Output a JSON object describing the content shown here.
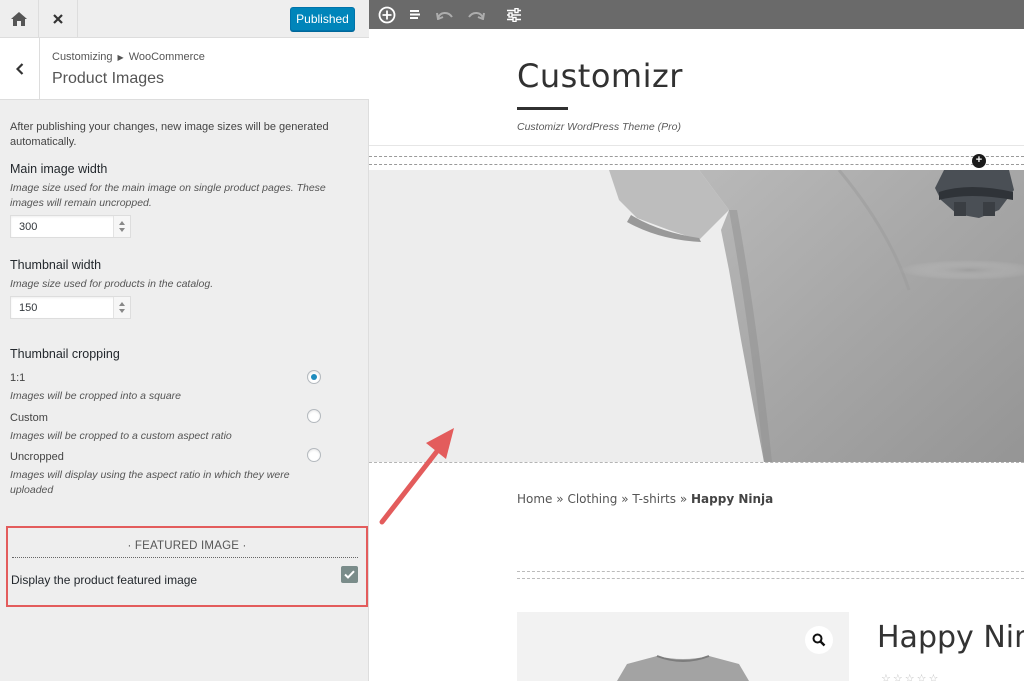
{
  "customizer": {
    "publish_label": "Published",
    "breadcrumb": {
      "root": "Customizing",
      "parent": "WooCommerce"
    },
    "section_title": "Product Images",
    "notice": "After publishing your changes, new image sizes will be generated automatically.",
    "main_image_width": {
      "title": "Main image width",
      "description": "Image size used for the main image on single product pages. These images will remain uncropped.",
      "value": "300"
    },
    "thumbnail_width": {
      "title": "Thumbnail width",
      "description": "Image size used for products in the catalog.",
      "value": "150"
    },
    "thumbnail_cropping": {
      "title": "Thumbnail cropping",
      "selected": "1:1",
      "options": [
        {
          "label": "1:1",
          "description": "Images will be cropped into a square"
        },
        {
          "label": "Custom",
          "description": "Images will be cropped to a custom aspect ratio"
        },
        {
          "label": "Uncropped",
          "description": "Images will display using the aspect ratio in which they were uploaded"
        }
      ]
    },
    "featured_image": {
      "heading": "· FEATURED IMAGE ·",
      "label": "Display the product featured image",
      "checked": true
    }
  },
  "preview": {
    "site_title": "Customizr",
    "tagline": "Customizr WordPress Theme (Pro)",
    "breadcrumb": {
      "home": "Home",
      "sep": "»",
      "cat1": "Clothing",
      "cat2": "T-shirts",
      "current": "Happy Ninja"
    },
    "product_title": "Happy Ninja",
    "rating_stars": "☆☆☆☆☆"
  },
  "colors": {
    "publish_button": "#0085ba",
    "highlight_box": "#e35c5c",
    "annotation_arrow": "#e35c5c",
    "checkbox": "#7a8c8a",
    "preview_toolbar": "#6a6a6a",
    "radio_selected": "#1e8cbe"
  },
  "icons": {
    "topbar": [
      "home-icon",
      "close-icon"
    ],
    "section": [
      "chevron-left-icon"
    ],
    "preview_toolbar": [
      "add-circle-icon",
      "menu-icon",
      "undo-icon",
      "redo-icon",
      "sliders-icon"
    ],
    "product": [
      "magnifier-icon"
    ]
  }
}
